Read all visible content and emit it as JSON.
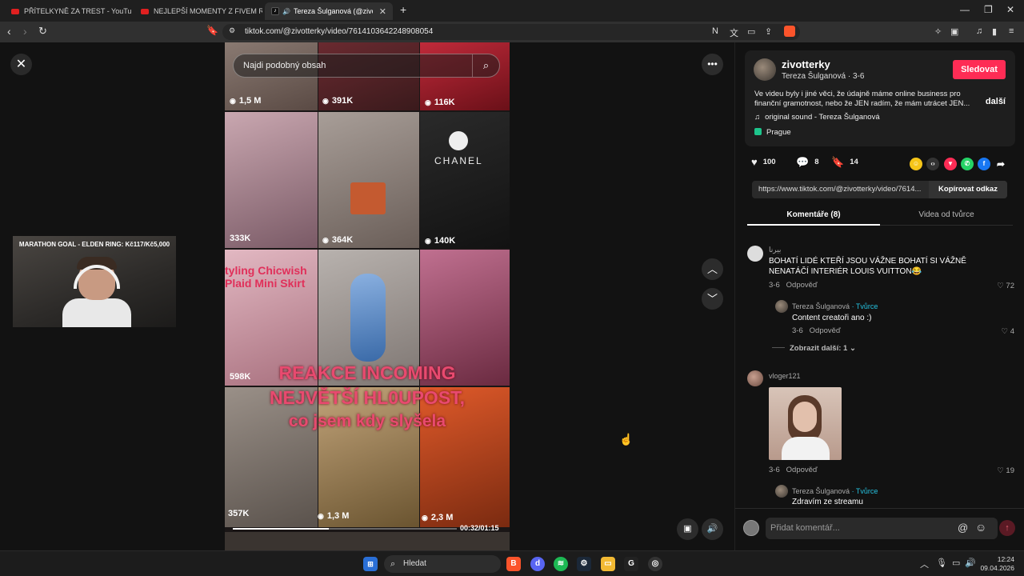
{
  "browser": {
    "tabs": [
      {
        "title": "PŘÍTELKYNĚ ZA TREST - YouTube",
        "favicon": "youtube-icon"
      },
      {
        "title": "NEJLEPŠÍ MOMENTY Z FIVEM RP !?! 😂",
        "favicon": "youtube-icon"
      },
      {
        "title": "Tereza Šulganová (@zivotterk",
        "favicon": "tiktok-icon"
      }
    ],
    "url": "tiktok.com/@zivotterky/video/7614103642248908054"
  },
  "pip": {
    "goal_text": "MARATHON GOAL - ELDEN RING: Kč117/Kč5,000"
  },
  "video": {
    "search_placeholder": "Najdi podobný obsah",
    "grid_counts": [
      "1,5 M",
      "391K",
      "116K",
      "333K",
      "364K",
      "140K",
      "598K",
      "357K",
      "1,3 M",
      "2,3 M"
    ],
    "overlay_lines": [
      "REAKCE INCOMING",
      "NEJVĚTŠÍ HL0UPOST,",
      "co jsem kdy slyšela"
    ],
    "chanel_label": "CHANEL",
    "styling_text": [
      "tyling Chicwish",
      "Plaid Mini Skirt"
    ],
    "time": "00:32/01:15",
    "progress": 0.43
  },
  "panel": {
    "username": "zivotterky",
    "display_name": "Tereza Šulganová",
    "date": "3-6",
    "follow_label": "Sledovat",
    "description": "Ve videu byly i jiné věci, že údajně máme online business pro finanční gramotnost, nebo že JEN radím, že mám utrácet JEN...",
    "more_label": "další",
    "sound": "original sound - Tereza Šulganová",
    "location": "Prague",
    "likes": "100",
    "comments": "8",
    "saves": "14",
    "link": "https://www.tiktok.com/@zivotterky/video/7614...",
    "copy_label": "Kopírovat odkaz",
    "tab_comments": "Komentáře (8)",
    "tab_videos": "Videa od tvůrce"
  },
  "comments": [
    {
      "name": "بيرنا",
      "text": "BOHATÍ LIDÉ KTEŘÍ JSOU VÁŽNE BOHATÍ SI VÁŽNĚ NENATÁČÍ INTERIÉR LOUIS VUITTON😂",
      "date": "3-6",
      "reply_label": "Odpověď",
      "likes": "72"
    },
    {
      "name": "Tereza Šulganová",
      "badge": "· Tvůrce",
      "text": "Content creatoři ano :)",
      "date": "3-6",
      "reply_label": "Odpověď",
      "likes": "4"
    },
    {
      "show_more": "Zobrazit další: 1"
    },
    {
      "name": "vloger121",
      "date": "3-6",
      "reply_label": "Odpověď",
      "likes": "19"
    },
    {
      "name": "Tereza Šulganová",
      "badge": "· Tvůrce",
      "text": "Zdravím ze streamu"
    }
  ],
  "comment_input_placeholder": "Přidat komentář...",
  "taskbar": {
    "search_label": "Hledat",
    "time": "12:24",
    "date": "09.04.2026"
  }
}
